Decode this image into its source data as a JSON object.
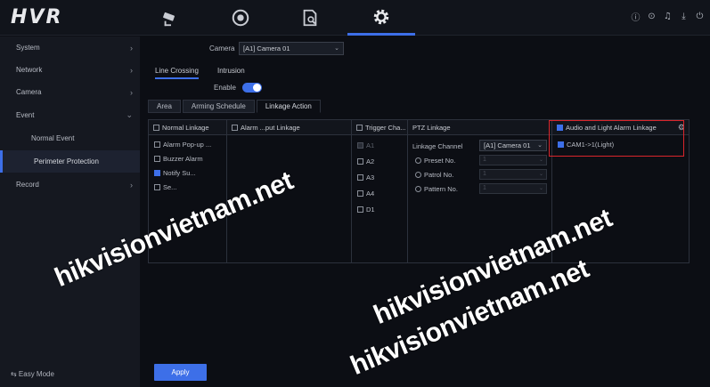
{
  "app": {
    "logo": "HVR"
  },
  "nav": {
    "tabs": [
      {
        "name": "live-view",
        "icon": "camera-icon"
      },
      {
        "name": "playback",
        "icon": "playback-icon"
      },
      {
        "name": "search",
        "icon": "file-search-icon"
      },
      {
        "name": "configuration",
        "icon": "gear-icon"
      }
    ],
    "active": "configuration"
  },
  "system_icons": [
    {
      "icon": "info-icon",
      "glyph": "ⓘ"
    },
    {
      "icon": "settings-circle-icon",
      "glyph": "⊙"
    },
    {
      "icon": "bell-icon",
      "glyph": "♫"
    },
    {
      "icon": "download-icon",
      "glyph": "⤓"
    },
    {
      "icon": "power-icon",
      "glyph": "⏻"
    }
  ],
  "sidebar": {
    "items": [
      {
        "label": "System",
        "chevron": "›"
      },
      {
        "label": "Network",
        "chevron": "›"
      },
      {
        "label": "Camera",
        "chevron": "›"
      },
      {
        "label": "Event",
        "chevron": "⌄"
      },
      {
        "label": "Normal Event"
      },
      {
        "label": "Perimeter Protection"
      },
      {
        "label": "Record",
        "chevron": "›"
      }
    ],
    "easy_mode": "⇆ Easy Mode"
  },
  "main": {
    "camera_label": "Camera",
    "camera_value": "[A1] Camera 01",
    "tabs": [
      "Line Crossing",
      "Intrusion"
    ],
    "enable_label": "Enable",
    "enabled": true,
    "subtabs": [
      "Area",
      "Arming Schedule",
      "Linkage Action"
    ],
    "normal_linkage": {
      "header": "Normal Linkage",
      "items": [
        {
          "label": "Alarm Pop-up ...",
          "checked": false
        },
        {
          "label": "Buzzer Alarm",
          "checked": false
        },
        {
          "label": "Notify Su...",
          "checked": true
        },
        {
          "label": "Se...",
          "checked": false
        }
      ]
    },
    "alarm_output": {
      "header": "Alarm ...put Linkage"
    },
    "trigger_channel": {
      "header": "Trigger Cha...",
      "items": [
        {
          "label": "A1",
          "disabled": true
        },
        {
          "label": "A2"
        },
        {
          "label": "A3"
        },
        {
          "label": "A4"
        },
        {
          "label": "D1"
        }
      ]
    },
    "ptz_linkage": {
      "header": "PTZ Linkage",
      "channel_label": "Linkage Channel",
      "channel_value": "[A1] Camera 01",
      "rows": [
        {
          "label": "Preset No.",
          "value": "1"
        },
        {
          "label": "Patrol No.",
          "value": "1"
        },
        {
          "label": "Pattern No.",
          "value": "1"
        }
      ]
    },
    "audio_light": {
      "header": "Audio and Light Alarm Linkage",
      "item": "CAM1->1(Light)"
    },
    "apply_label": "Apply"
  },
  "watermarks": [
    "hikvisionvietnam.net",
    "hikvisionvietnam.net",
    "hikvisionvietnam.net"
  ]
}
